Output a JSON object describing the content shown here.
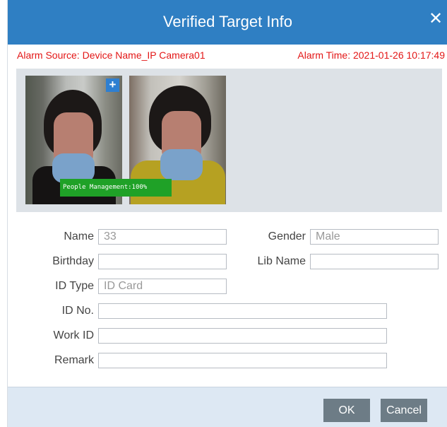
{
  "dialog": {
    "title": "Verified Target Info",
    "close_label": "✕"
  },
  "alarm": {
    "source": "Alarm Source: Device Name_IP Camera01",
    "time": "Alarm Time: 2021-01-26 10:17:49"
  },
  "images": {
    "add_label": "+",
    "match_label": "People Management:100%"
  },
  "form": {
    "name_label": "Name",
    "name_value": "33",
    "gender_label": "Gender",
    "gender_value": "Male",
    "birthday_label": "Birthday",
    "birthday_value": "",
    "lib_name_label": "Lib Name",
    "lib_name_value": "",
    "id_type_label": "ID Type",
    "id_type_value": "ID Card",
    "id_no_label": "ID No.",
    "id_no_value": "",
    "work_id_label": "Work ID",
    "work_id_value": "",
    "remark_label": "Remark",
    "remark_value": ""
  },
  "footer": {
    "ok_label": "OK",
    "cancel_label": "Cancel"
  },
  "colors": {
    "titlebar": "#2f7fc3",
    "alarm_text": "#e31616",
    "match_badge": "#1fa127",
    "button": "#6d7c86"
  }
}
